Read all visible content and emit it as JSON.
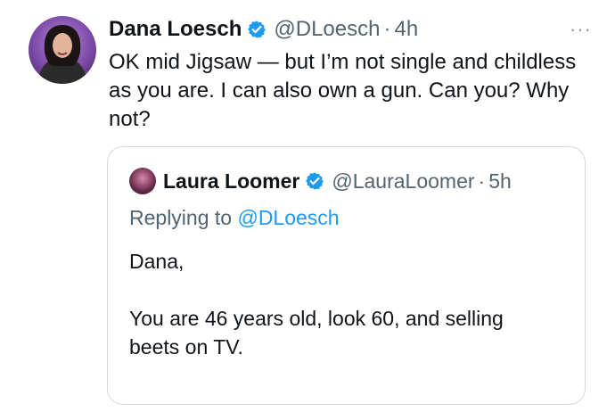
{
  "tweet": {
    "author_name": "Dana Loesch",
    "handle": "@DLoesch",
    "separator": "·",
    "time": "4h",
    "more_menu": "···",
    "text": "OK mid Jigsaw — but I’m not single and childless as you are. I can also own a gun. Can you? Why not?"
  },
  "quoted": {
    "author_name": "Laura Loomer",
    "handle": "@LauraLoomer",
    "separator": "·",
    "time": "5h",
    "replying_prefix": "Replying to",
    "replying_to": "@DLoesch",
    "paragraph1": "Dana,",
    "paragraph2": "You are 46 years old, look 60, and selling beets on TV."
  },
  "colors": {
    "verified_blue": "#1d9bf0",
    "text": "#0f1419",
    "muted": "#536471",
    "border": "#cfd9de"
  },
  "icons": {
    "verified": "verified-badge-icon",
    "more": "more-icon"
  }
}
